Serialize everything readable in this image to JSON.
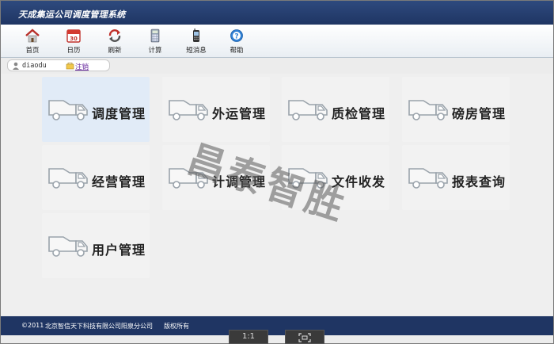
{
  "app": {
    "title": "天成集运公司调度管理系统"
  },
  "toolbar": {
    "items": [
      {
        "label": "首页",
        "icon": "home-icon"
      },
      {
        "label": "日历",
        "icon": "calendar-icon"
      },
      {
        "label": "刷新",
        "icon": "refresh-icon"
      },
      {
        "label": "计算",
        "icon": "calculator-icon"
      },
      {
        "label": "短消息",
        "icon": "mobile-phone-icon"
      },
      {
        "label": "帮助",
        "icon": "help-icon"
      }
    ],
    "calendar_day": "30"
  },
  "user": {
    "name": "diaodu",
    "logout_label": "注销"
  },
  "modules": [
    {
      "label": "调度管理",
      "active": true
    },
    {
      "label": "外运管理"
    },
    {
      "label": "质检管理"
    },
    {
      "label": "磅房管理"
    },
    {
      "label": "经营管理"
    },
    {
      "label": "计调管理"
    },
    {
      "label": "文件收发"
    },
    {
      "label": "报表查询"
    },
    {
      "label": "用户管理"
    }
  ],
  "watermark": "昌泰智胜",
  "footer": {
    "copyright": "©2011",
    "company": "北京智信天下科技有限公司阳泉分公司",
    "rights": "版权所有"
  },
  "viewer": {
    "actual_size_label": "1:1",
    "fit_label": "fit-screen-icon"
  },
  "colors": {
    "header": "#1f3563",
    "active_tile": "#e1ebf7"
  }
}
